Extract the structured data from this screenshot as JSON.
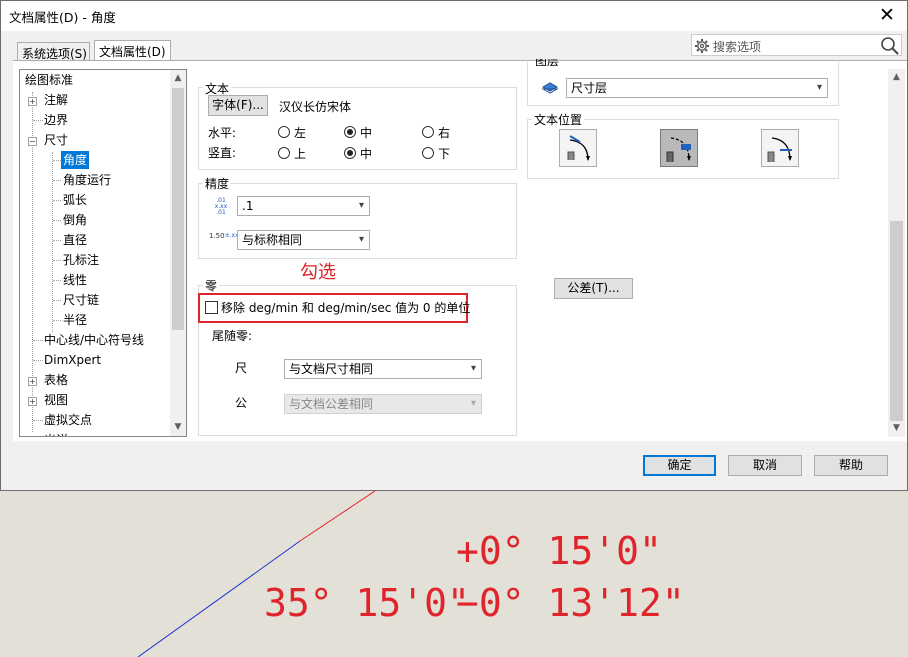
{
  "window": {
    "title": "文档属性(D) - 角度",
    "close_glyph": "✕"
  },
  "tabs": [
    {
      "label": "系统选项(S)",
      "active": false
    },
    {
      "label": "文档属性(D)",
      "active": true
    }
  ],
  "search": {
    "placeholder": "搜索选项"
  },
  "tree": {
    "items": [
      {
        "label": "绘图标准",
        "expander": ""
      },
      {
        "label": "注解",
        "expander": "+"
      },
      {
        "label": "边界",
        "expander": ""
      },
      {
        "label": "尺寸",
        "expander": "−"
      },
      {
        "label": "角度",
        "expander": "",
        "selected": true
      },
      {
        "label": "角度运行",
        "expander": ""
      },
      {
        "label": "弧长",
        "expander": ""
      },
      {
        "label": "倒角",
        "expander": ""
      },
      {
        "label": "直径",
        "expander": ""
      },
      {
        "label": "孔标注",
        "expander": ""
      },
      {
        "label": "线性",
        "expander": ""
      },
      {
        "label": "尺寸链",
        "expander": ""
      },
      {
        "label": "半径",
        "expander": ""
      },
      {
        "label": "中心线/中心符号线",
        "expander": ""
      },
      {
        "label": "DimXpert",
        "expander": ""
      },
      {
        "label": "表格",
        "expander": "+"
      },
      {
        "label": "视图",
        "expander": "+"
      },
      {
        "label": "虚拟交点",
        "expander": ""
      },
      {
        "label": "出详",
        "expander": "+"
      }
    ]
  },
  "text_group": {
    "title": "文本",
    "font_button": "字体(F)...",
    "font_name": "汉仪长仿宋体",
    "horizontal_label": "水平:",
    "vertical_label": "竖直:",
    "horizontal_options": [
      {
        "label": "左",
        "checked": false
      },
      {
        "label": "中",
        "checked": true
      },
      {
        "label": "右",
        "checked": false
      }
    ],
    "vertical_options": [
      {
        "label": "上",
        "checked": false
      },
      {
        "label": "中",
        "checked": true
      },
      {
        "label": "下",
        "checked": false
      }
    ]
  },
  "precision_group": {
    "title": "精度",
    "primary_value": ".1",
    "tolerance_value": "与标称相同",
    "icon1_text": ".01",
    "icon2_text": "1.50"
  },
  "zero_group": {
    "title": "零",
    "remove_checkbox_label": "移除 deg/min 和 deg/min/sec 值为 0 的单位",
    "remove_checked": false,
    "trailing_label": "尾随零:",
    "dim_label": "尺",
    "dim_value": "与文档尺寸相同",
    "tol_label": "公",
    "tol_value": "与文档公差相同"
  },
  "annotation": {
    "text": "勾选"
  },
  "layer_group": {
    "title": "图层",
    "value": "尺寸层"
  },
  "text_position_group": {
    "title": "文本位置"
  },
  "tolerance_button": "公差(T)...",
  "footer": {
    "ok": "确定",
    "cancel": "取消",
    "help": "帮助"
  },
  "drawing": {
    "upper_tolerance": "+0° 15'0\"",
    "nominal": "35° 15'0\"",
    "lower_tolerance": "−0° 13'12\""
  },
  "colors": {
    "accent": "#0078d7",
    "highlight_red": "#e0242b",
    "selection_bg": "#0078d7"
  }
}
